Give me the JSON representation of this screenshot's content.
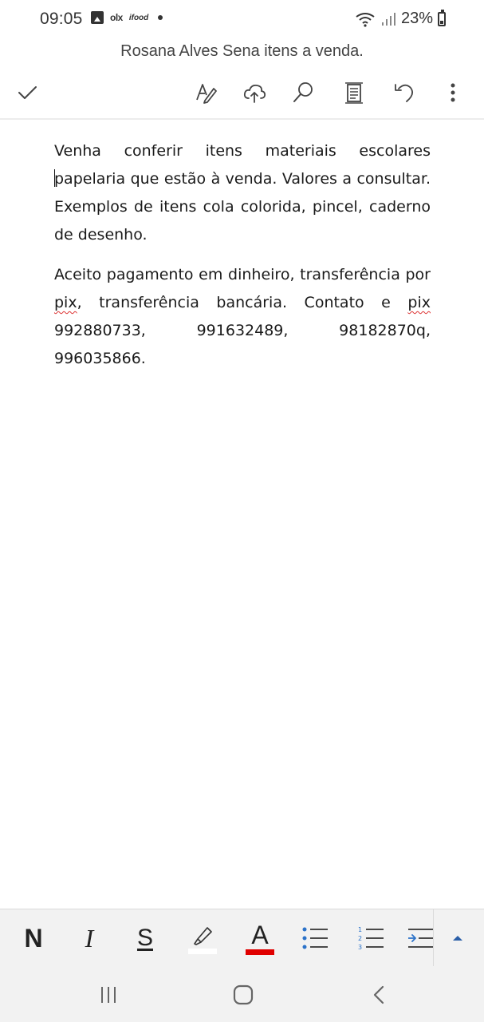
{
  "status_bar": {
    "time": "09:05",
    "notifications": {
      "image": "gallery-icon",
      "olx": "olx",
      "ifood": "ifood",
      "more": "dot-icon"
    },
    "battery": "23%"
  },
  "document": {
    "title": "Rosana Alves Sena itens a venda.",
    "paragraph1": {
      "line1": "Venha conferir itens materiais escolares",
      "rest": "papelaria que estão à venda. Valores a consultar. Exemplos de itens cola colorida, pincel, caderno de desenho."
    },
    "paragraph2": {
      "start": "Aceito pagamento em dinheiro, transferência por ",
      "pix1": "pix",
      "middle": ", transferência bancária. Contato e ",
      "pix2": "pix",
      "end": " 992880733, 991632489, 98182870q, 996035866."
    }
  },
  "toolbar": {
    "icons": [
      "check-icon",
      "format-pen-icon",
      "cloud-upload-icon",
      "search-icon",
      "page-view-icon",
      "undo-icon",
      "more-vertical-icon"
    ]
  },
  "format_bar": {
    "bold": "N",
    "italic": "I",
    "underline": "S",
    "font_color_letter": "A",
    "font_color": "#e00000",
    "highlight_color": "#ffffff"
  },
  "nav_bar": {
    "icons": [
      "recents-icon",
      "home-icon",
      "back-icon"
    ]
  }
}
